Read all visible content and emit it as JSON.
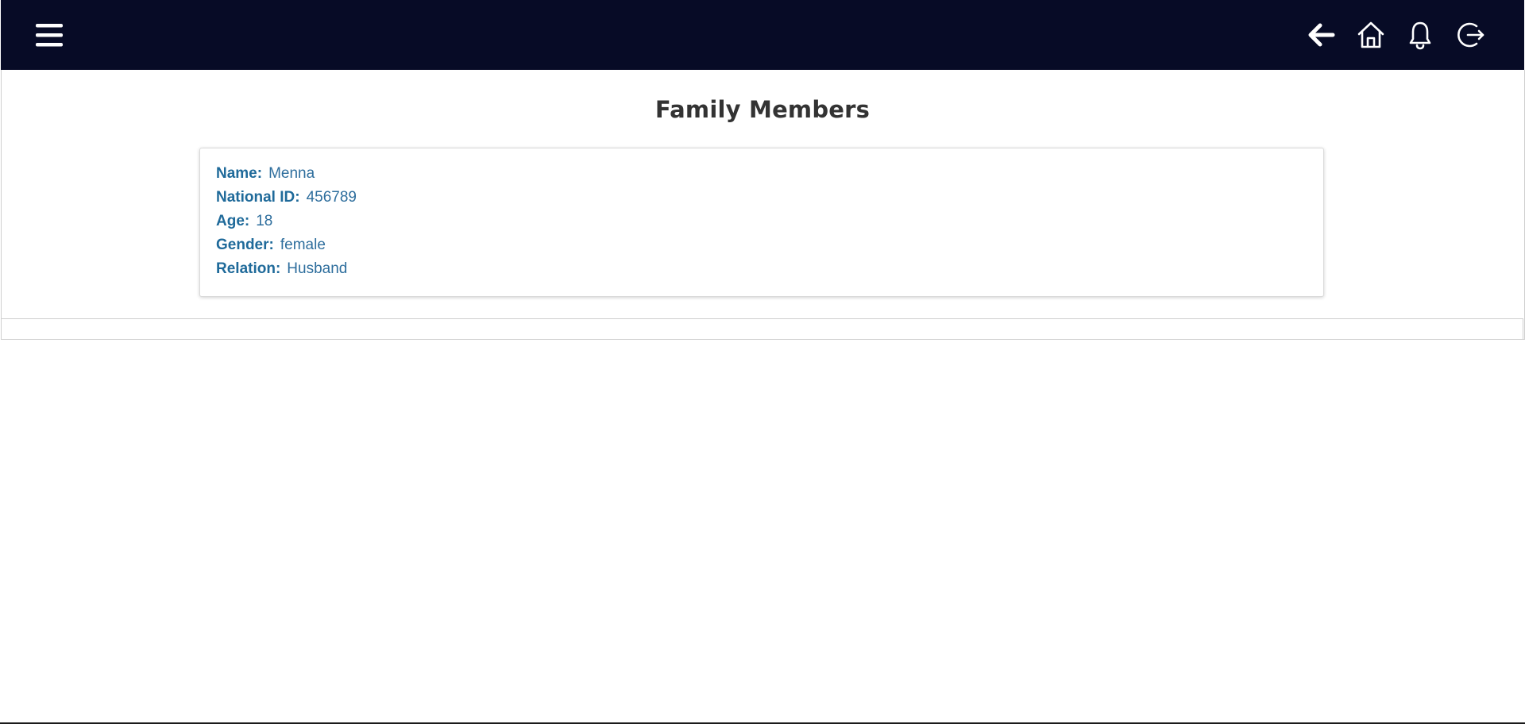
{
  "header": {
    "menu_icon": "hamburger-menu-icon",
    "icons": [
      "back-arrow-icon",
      "home-icon",
      "bell-icon",
      "logout-icon"
    ],
    "background_color": "#070b26"
  },
  "page": {
    "title": "Family Members"
  },
  "member": {
    "name_label": "Name:",
    "name": "Menna",
    "national_id_label": "National ID:",
    "national_id": "456789",
    "age_label": "Age:",
    "age": "18",
    "gender_label": "Gender:",
    "gender": "female",
    "relation_label": "Relation:",
    "relation": "Husband"
  },
  "colors": {
    "label": "#1f6a9a",
    "title": "#333333"
  }
}
